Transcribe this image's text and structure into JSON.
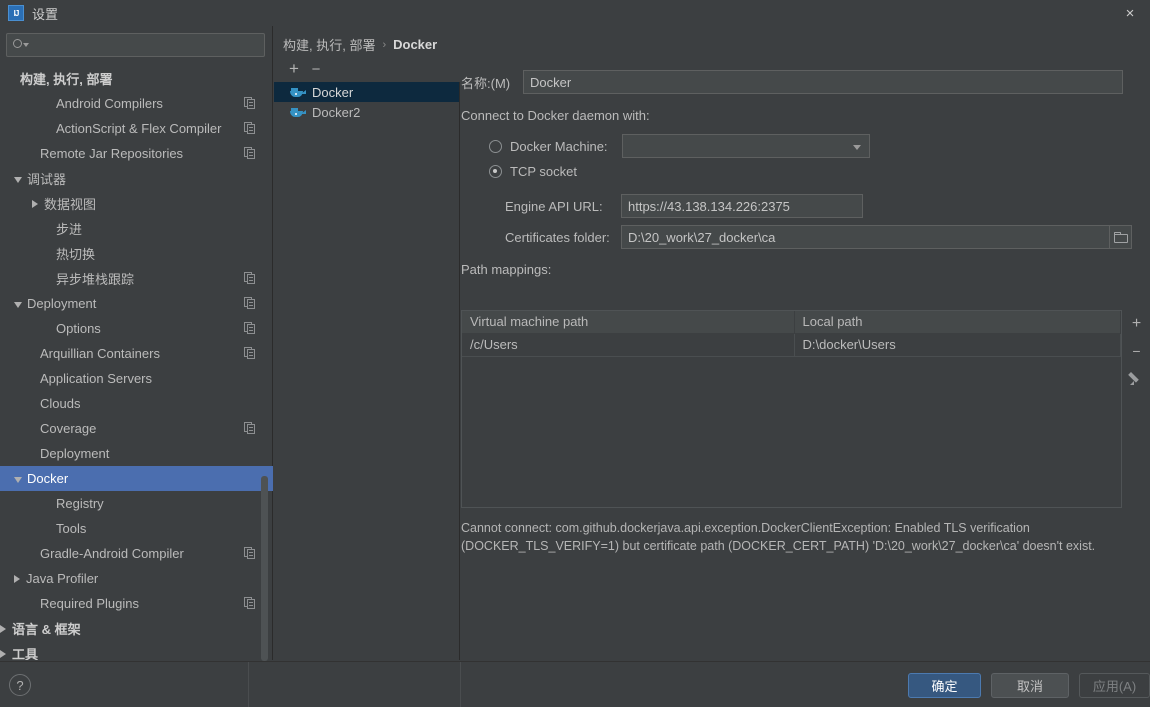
{
  "window": {
    "title": "设置",
    "logo_text": "IJ",
    "close_icon": "×"
  },
  "search": {
    "value": "",
    "placeholder": ""
  },
  "sidebar": {
    "items": [
      {
        "label": "构建, 执行, 部署",
        "indent": 8,
        "arrow": "none",
        "bold": true,
        "copy": false,
        "selected": false
      },
      {
        "label": "Android Compilers",
        "indent": 44,
        "arrow": "none",
        "bold": false,
        "copy": true,
        "selected": false
      },
      {
        "label": "ActionScript & Flex Compiler",
        "indent": 44,
        "arrow": "none",
        "bold": false,
        "copy": true,
        "selected": false
      },
      {
        "label": "Remote Jar Repositories",
        "indent": 28,
        "arrow": "none",
        "bold": false,
        "copy": true,
        "selected": false
      },
      {
        "label": "调试器",
        "indent": 14,
        "arrow": "open",
        "bold": false,
        "copy": false,
        "selected": false
      },
      {
        "label": "数据视图",
        "indent": 32,
        "arrow": "closed",
        "bold": false,
        "copy": false,
        "selected": false
      },
      {
        "label": "步进",
        "indent": 44,
        "arrow": "none",
        "bold": false,
        "copy": false,
        "selected": false
      },
      {
        "label": "热切换",
        "indent": 44,
        "arrow": "none",
        "bold": false,
        "copy": false,
        "selected": false
      },
      {
        "label": "异步堆栈跟踪",
        "indent": 44,
        "arrow": "none",
        "bold": false,
        "copy": true,
        "selected": false
      },
      {
        "label": "Deployment",
        "indent": 14,
        "arrow": "open",
        "bold": false,
        "copy": true,
        "selected": false
      },
      {
        "label": "Options",
        "indent": 44,
        "arrow": "none",
        "bold": false,
        "copy": true,
        "selected": false
      },
      {
        "label": "Arquillian Containers",
        "indent": 28,
        "arrow": "none",
        "bold": false,
        "copy": true,
        "selected": false
      },
      {
        "label": "Application Servers",
        "indent": 28,
        "arrow": "none",
        "bold": false,
        "copy": false,
        "selected": false
      },
      {
        "label": "Clouds",
        "indent": 28,
        "arrow": "none",
        "bold": false,
        "copy": false,
        "selected": false
      },
      {
        "label": "Coverage",
        "indent": 28,
        "arrow": "none",
        "bold": false,
        "copy": true,
        "selected": false
      },
      {
        "label": "Deployment",
        "indent": 28,
        "arrow": "none",
        "bold": false,
        "copy": false,
        "selected": false
      },
      {
        "label": "Docker",
        "indent": 14,
        "arrow": "open",
        "bold": false,
        "copy": false,
        "selected": true
      },
      {
        "label": "Registry",
        "indent": 44,
        "arrow": "none",
        "bold": false,
        "copy": false,
        "selected": false
      },
      {
        "label": "Tools",
        "indent": 44,
        "arrow": "none",
        "bold": false,
        "copy": false,
        "selected": false
      },
      {
        "label": "Gradle-Android Compiler",
        "indent": 28,
        "arrow": "none",
        "bold": false,
        "copy": true,
        "selected": false
      },
      {
        "label": "Java Profiler",
        "indent": 14,
        "arrow": "closed",
        "bold": false,
        "copy": false,
        "selected": false
      },
      {
        "label": "Required Plugins",
        "indent": 28,
        "arrow": "none",
        "bold": false,
        "copy": true,
        "selected": false
      },
      {
        "label": "语言 & 框架",
        "indent": 0,
        "arrow": "closed",
        "bold": true,
        "copy": false,
        "selected": false
      },
      {
        "label": "工具",
        "indent": 0,
        "arrow": "closed",
        "bold": true,
        "copy": false,
        "selected": false
      }
    ]
  },
  "breadcrumb": {
    "root": "构建, 执行, 部署",
    "separator": "›",
    "current": "Docker"
  },
  "config_list": {
    "add_label": "+",
    "remove_label": "−",
    "items": [
      {
        "label": "Docker",
        "selected": true
      },
      {
        "label": "Docker2",
        "selected": false
      }
    ]
  },
  "detail": {
    "name_label": "名称:(M)",
    "name_value": "Docker",
    "connect_label": "Connect to Docker daemon with:",
    "docker_machine_label": "Docker Machine:",
    "docker_machine_value": "",
    "docker_machine_selected": false,
    "tcp_socket_label": "TCP socket",
    "tcp_socket_selected": true,
    "engine_api_label": "Engine API URL:",
    "engine_api_value": "https://43.138.134.226:2375",
    "certificates_label": "Certificates folder:",
    "certificates_value": "D:\\20_work\\27_docker\\ca",
    "path_mappings_label": "Path mappings:",
    "table": {
      "headers": [
        "Virtual machine path",
        "Local path"
      ],
      "rows": [
        [
          "/c/Users",
          "D:\\docker\\Users"
        ]
      ]
    },
    "table_buttons": {
      "add": "+",
      "remove": "−",
      "edit": "edit-pencil-icon"
    },
    "error_message": "Cannot connect: com.github.dockerjava.api.exception.DockerClientException: Enabled TLS verification (DOCKER_TLS_VERIFY=1) but certificate path (DOCKER_CERT_PATH) 'D:\\20_work\\27_docker\\ca' doesn't exist."
  },
  "footer": {
    "help_label": "?",
    "ok_label": "确定",
    "cancel_label": "取消",
    "apply_label": "应用(A)"
  },
  "colors": {
    "background": "#3c3f41",
    "selection_blue": "#4b6eaf",
    "list_selection": "#0d293e",
    "field_bg": "#45494a",
    "accent_button": "#365880",
    "docker_icon": "#3592c4",
    "text": "#bbbbbb"
  }
}
